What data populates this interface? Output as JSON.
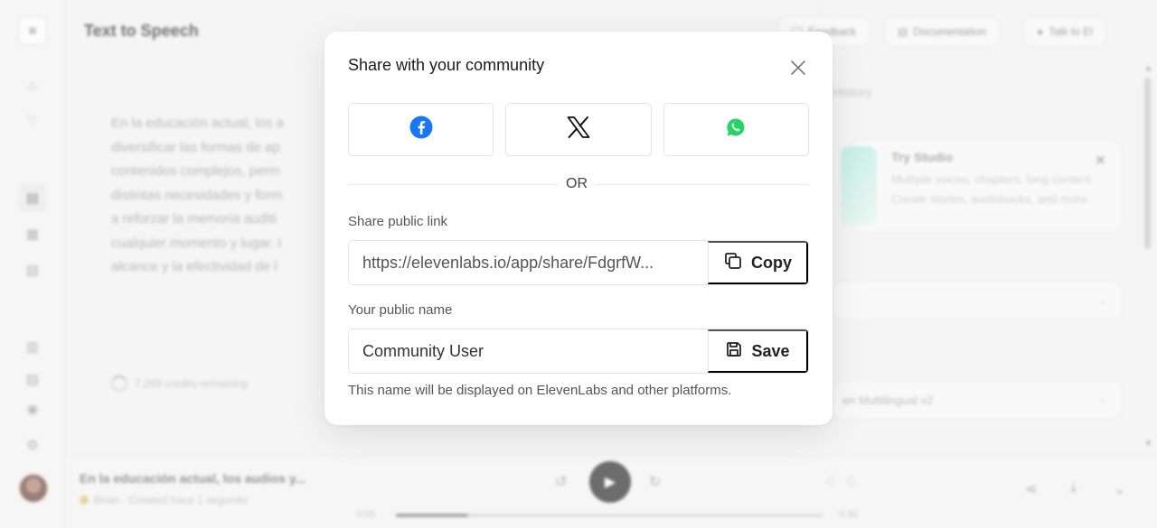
{
  "background": {
    "page_title": "Text to Speech",
    "header_buttons": [
      "Feedback",
      "Documentation",
      "Talk to El"
    ],
    "editor_text": "En la educación actual, los a\ndiversificar las formas de ap\ncontenidos complejos, perm\ndistintas necesidades y form\na reforzar la memoria auditi\ncualquier momento y lugar. I\nalcance y la efectividad de l",
    "credits": "7,269 credits remaining",
    "history_tab": "History",
    "promo": {
      "title": "Try Studio",
      "description": "Multiple voices, chapters, long content. Create stories, audiobooks, and more."
    },
    "model_label": "en Multilingual v2",
    "player": {
      "title": "En la educación actual, los audios y...",
      "subtitle": "Brian · Created hace 1 segundo",
      "time_current": "0:05",
      "time_total": "0:30",
      "progress": 0.17
    }
  },
  "modal": {
    "title": "Share with your community",
    "share_buttons": [
      "facebook",
      "x",
      "whatsapp"
    ],
    "or_text": "OR",
    "public_link": {
      "label": "Share public link",
      "value": "https://elevenlabs.io/app/share/FdgrfW...",
      "copy_label": "Copy"
    },
    "public_name": {
      "label": "Your public name",
      "value": "Community User",
      "save_label": "Save"
    },
    "helper_text": "This name will be displayed on ElevenLabs and other platforms."
  },
  "colors": {
    "facebook": "#1877F2",
    "whatsapp": "#25D366",
    "x": "#111111"
  },
  "icons": [
    "menu-icon",
    "home-icon",
    "voices-icon",
    "tts-icon",
    "sts-icon",
    "sfx-icon",
    "studio-icon",
    "dubbing-icon",
    "settings-icon",
    "close-icon",
    "facebook-icon",
    "x-icon",
    "whatsapp-icon",
    "copy-icon",
    "save-icon"
  ]
}
